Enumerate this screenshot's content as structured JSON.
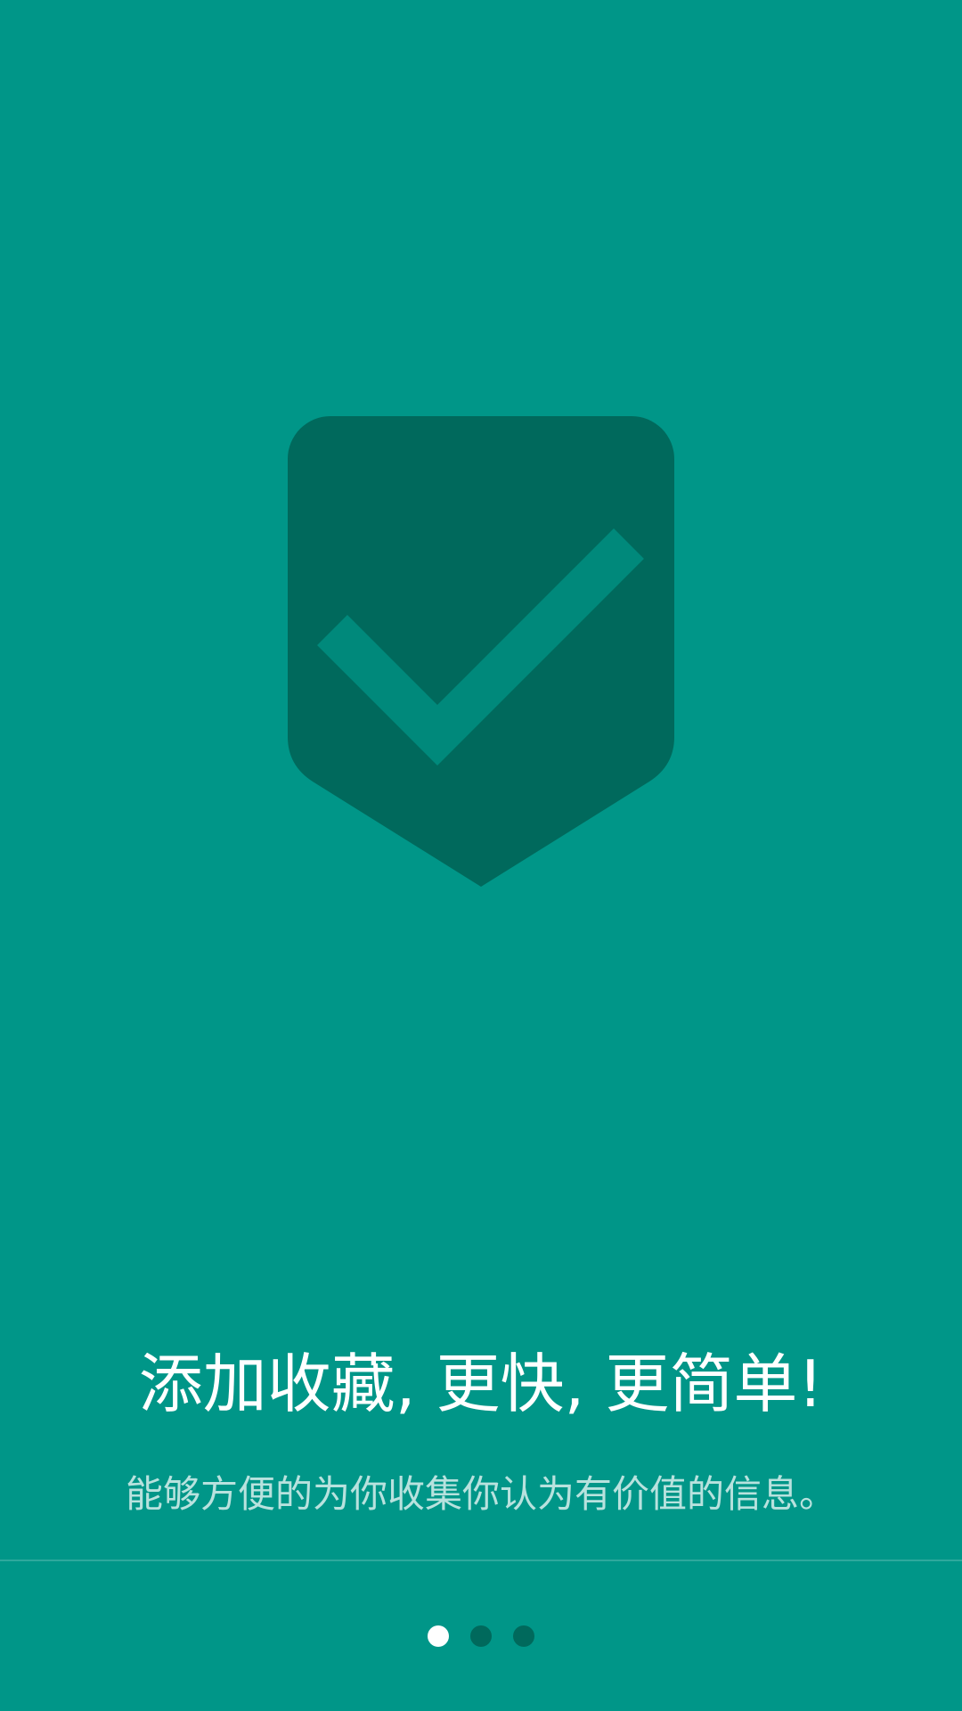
{
  "onboarding": {
    "headline": "添加收藏, 更快, 更简单!",
    "subtitle": "能够方便的为你收集你认为有价值的信息。",
    "illustration_icon": "check-shield-icon",
    "page_indicator": {
      "total": 3,
      "active_index": 0
    }
  },
  "colors": {
    "background": "#009688",
    "badge": "#00695C",
    "check": "#00897B",
    "dot_active": "#FFFFFF",
    "dot_inactive": "#00695C"
  }
}
